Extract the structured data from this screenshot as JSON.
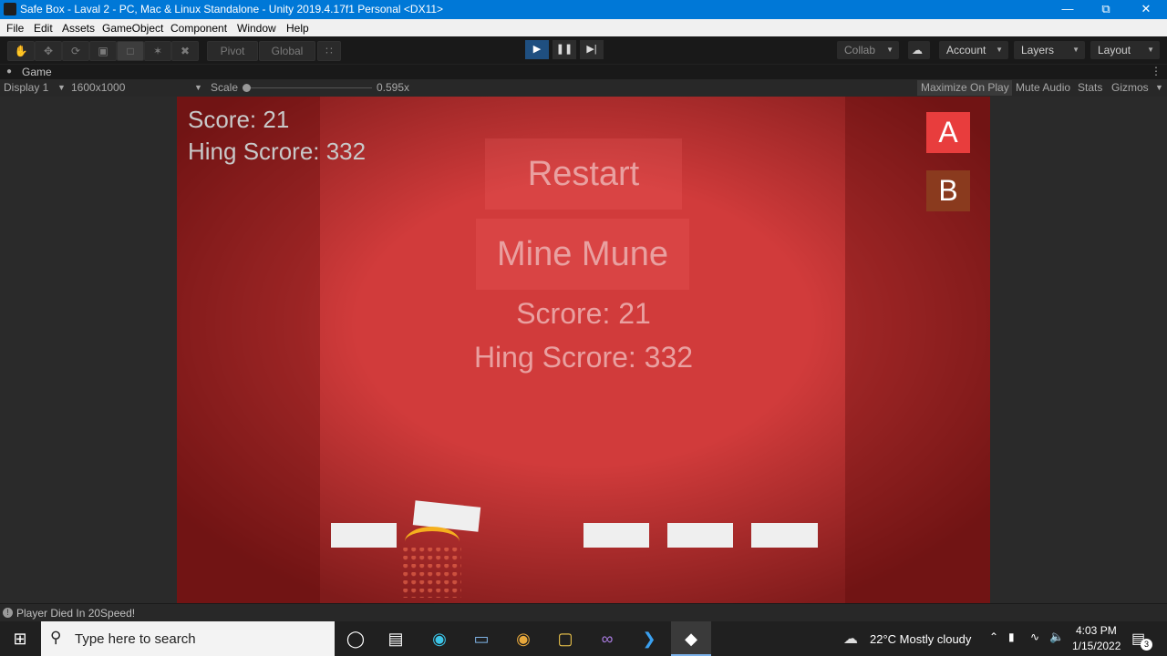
{
  "window": {
    "title": "Safe Box - Laval 2 - PC, Mac & Linux Standalone - Unity 2019.4.17f1 Personal <DX11>",
    "min_icon": "minimize-icon",
    "max_icon": "restore-icon",
    "close_icon": "close-icon"
  },
  "menu": [
    "File",
    "Edit",
    "Assets",
    "GameObject",
    "Component",
    "Window",
    "Help"
  ],
  "toolbar": {
    "pivot": "Pivot",
    "global": "Global",
    "collab": "Collab",
    "account": "Account",
    "layers": "Layers",
    "layout": "Layout",
    "play_active": true
  },
  "game_view": {
    "tab_label": "Game",
    "display": "Display 1",
    "resolution": "1600x1000",
    "scale_label": "Scale",
    "scale_value": "0.595x",
    "maximize": "Maximize On Play",
    "mute": "Mute Audio",
    "stats": "Stats",
    "gizmos": "Gizmos"
  },
  "game": {
    "hud_score": "Score: 21",
    "hud_high": "Hing Scrore: 332",
    "restart": "Restart",
    "main_menu": "Mine Mune",
    "overlay_score": "Scrore: 21",
    "overlay_high": "Hing Scrore: 332",
    "btn_a": "A",
    "btn_b": "B",
    "colors": {
      "background": "#d13b3b",
      "btn_a": "#e83d3d",
      "btn_b": "#8a3a1e"
    }
  },
  "status": {
    "message": "Player Died In 20Speed!"
  },
  "taskbar": {
    "search_placeholder": "Type here to search",
    "weather": "22°C  Mostly cloudy",
    "time": "4:03 PM",
    "date": "1/15/2022",
    "notifications": "3"
  }
}
